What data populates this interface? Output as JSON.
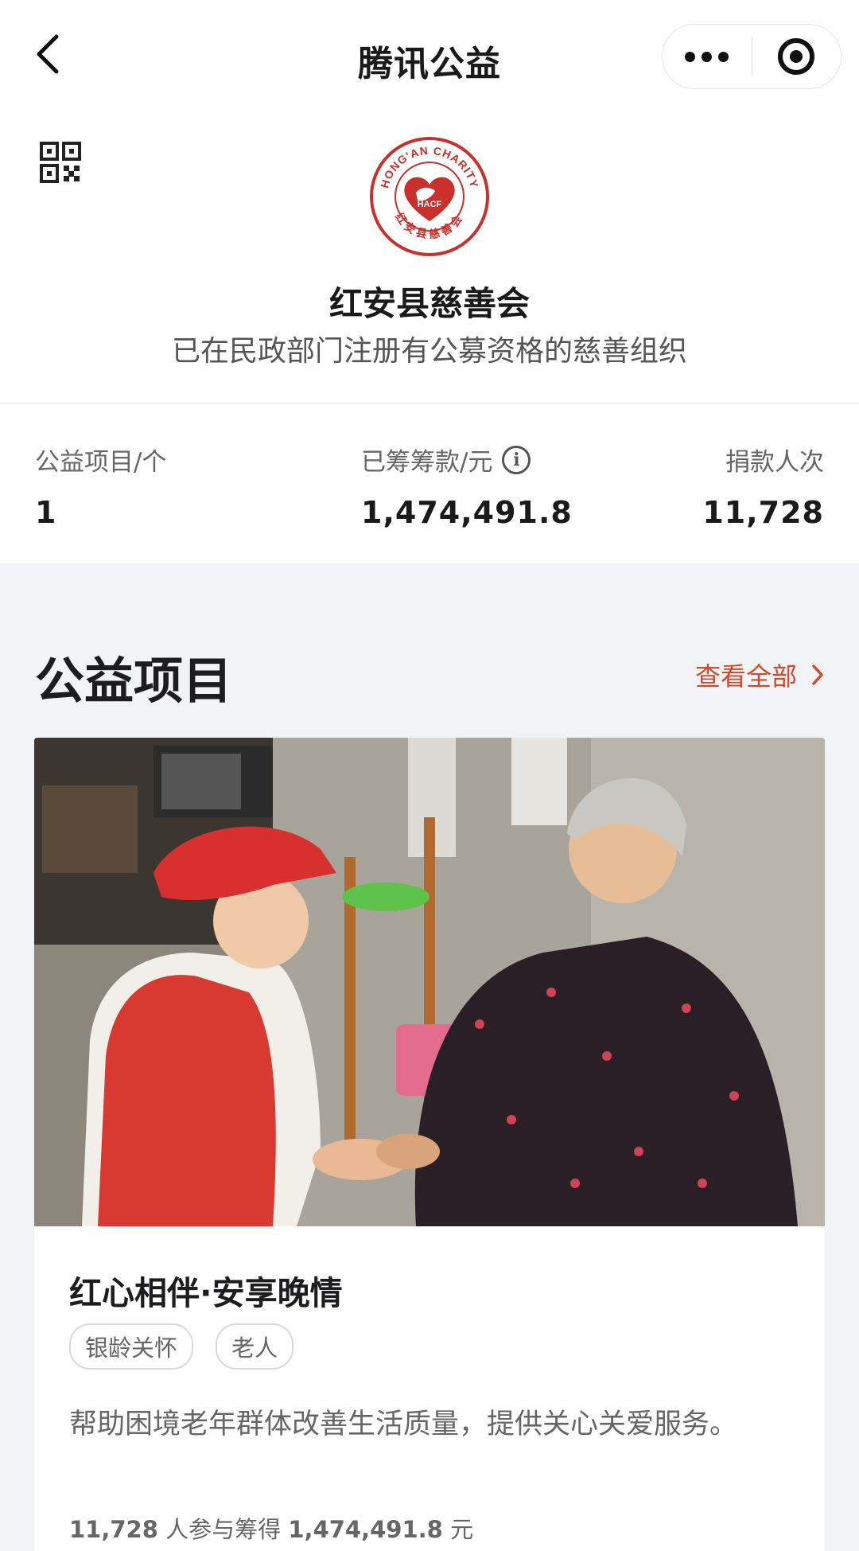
{
  "nav": {
    "title": "腾讯公益"
  },
  "org": {
    "logo_text_top": "HONG'AN CHARITY",
    "logo_text_center": "HACF",
    "logo_text_bottom": "红安县慈善会",
    "name": "红安县慈善会",
    "description": "已在民政部门注册有公募资格的慈善组织"
  },
  "stats": {
    "projects_label": "公益项目/个",
    "projects_value": "1",
    "raised_label": "已筹筹款/元",
    "raised_value": "1,474,491.8",
    "donors_label": "捐款人次",
    "donors_value": "11,728"
  },
  "section": {
    "title": "公益项目",
    "view_all": "查看全部"
  },
  "project": {
    "title": "红心相伴·安享晚情",
    "tags": [
      "银龄关怀",
      "老人"
    ],
    "description": "帮助困境老年群体改善生活质量，提供关心关爱服务。",
    "participants": "11,728",
    "participants_suffix": "人参与筹得",
    "amount": "1,474,491.8",
    "amount_unit": "元"
  },
  "colors": {
    "accent": "#d2492a",
    "logo_red": "#c9302c",
    "background": "#f2f3f7"
  },
  "icons": [
    "back-arrow-icon",
    "more-dots-icon",
    "close-circle-icon",
    "qr-code-icon",
    "info-icon",
    "chevron-right-icon"
  ]
}
